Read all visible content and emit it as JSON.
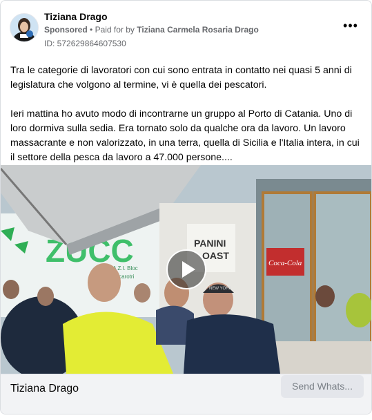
{
  "advertiser": {
    "name": "Tiziana Drago",
    "sponsored_label": "Sponsored",
    "paid_for_prefix": "Paid for by",
    "paid_for_by": "Tiziana Carmela Rosaria Drago",
    "ad_id": "ID: 572629864607530"
  },
  "menu": {
    "icon": "more-options-icon",
    "label": "•••"
  },
  "post": {
    "paragraph_1": "Tra le categorie di lavoratori con cui sono entrata in contatto nei quasi 5 anni di legislatura che volgono al termine, vi è quella dei pescatori.",
    "paragraph_2": "Ieri mattina ho avuto modo di incontrarne un gruppo al Porto di Catania. Uno di loro dormiva sulla sedia. Era tornato solo da qualche ora da lavoro. Un lavoro massacrante e non valorizzato, in una terra, quella di Sicilia e l'Italia intera, in cui il settore della pesca da lavoro a 47.000 persone...."
  },
  "video": {
    "play_icon": "play-icon",
    "scene_signs": {
      "left_sign": "ZUCC",
      "left_small": "IA Z.I. Bloc",
      "left_small_2": "ruccarotri",
      "panini_1": "PANINI",
      "panini_2": "OAST",
      "coke": "Coca-Cola",
      "cap_text": "NEW YORK"
    }
  },
  "footer": {
    "title": "Tiziana Drago",
    "cta_label": "Send Whats..."
  },
  "colors": {
    "text_primary": "#050505",
    "text_secondary": "#65676b",
    "footer_bg": "#f2f3f5",
    "cta_bg": "#e4e6eb",
    "border": "#dadde1"
  }
}
